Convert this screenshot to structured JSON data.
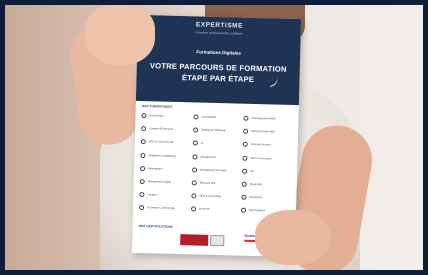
{
  "brochure": {
    "logo": "EXPERTISME",
    "logo_sub": "formation professionnelle certifiante",
    "kicker": "Formations Digitales",
    "title_line1": "VOTRE PARCOURS DE FORMATION",
    "title_line2": "ÉTAPE PAR ÉTAPE",
    "section_thematiques": "NOS THÉMATIQUES",
    "section_certifications": "NOS CERTIFICATIONS",
    "items": [
      "Bureautique",
      "Comptabilité",
      "Développement Web",
      "Création d'Entreprise",
      "Intelligence Artificielle",
      "Référencement Web",
      "DPO & Cybersécurité",
      "IA",
      "Réseaux Sociaux",
      "Graphisme & Marketing",
      "Management",
      "PAO & Conception",
      "Informatique",
      "Management de Projet",
      "RH",
      "Management Digital",
      "Microsoft 365",
      "Excel VBA",
      "Langues",
      "SEO & Community",
      "Photoshop",
      "Formation Commerciale",
      "Power BI",
      "Web Analytics"
    ],
    "cert_label": "Qualiopi"
  }
}
